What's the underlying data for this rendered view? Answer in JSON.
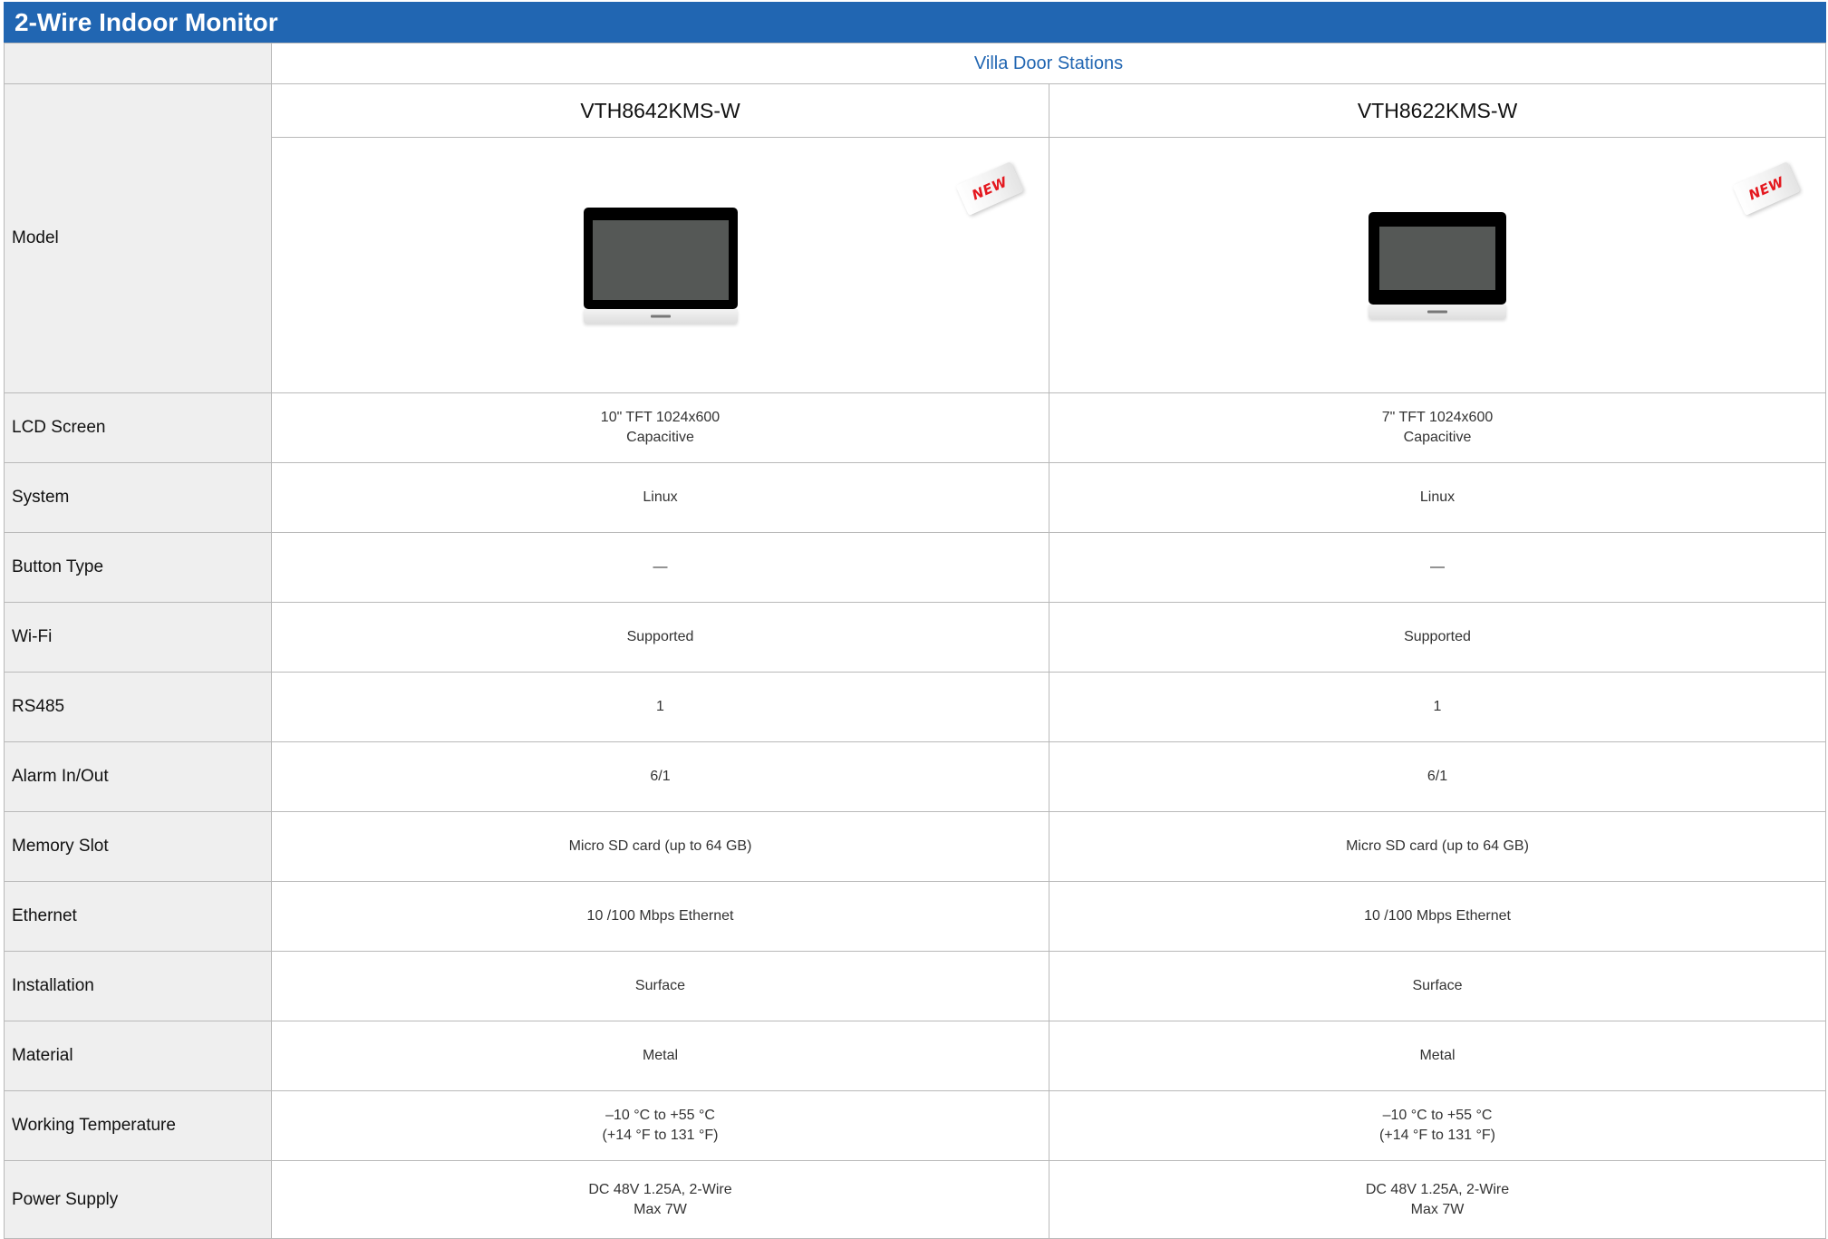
{
  "title": "2-Wire Indoor Monitor",
  "series": "Villa Door Stations",
  "colors": {
    "header_bg": "#2166b2",
    "badge_text": "#e4181f",
    "label_bg": "#efefef"
  },
  "models": [
    {
      "name": "VTH8642KMS-W",
      "badge": "NEW"
    },
    {
      "name": "VTH8622KMS-W",
      "badge": "NEW"
    }
  ],
  "rows": {
    "model_label": "Model",
    "lcd": {
      "label": "LCD Screen",
      "values": [
        [
          "10\" TFT 1024x600",
          "Capacitive"
        ],
        [
          "7\" TFT 1024x600",
          "Capacitive"
        ]
      ]
    },
    "system": {
      "label": "System",
      "values": [
        "Linux",
        "Linux"
      ]
    },
    "button": {
      "label": "Button Type",
      "values": [
        "—",
        "—"
      ]
    },
    "wifi": {
      "label": "Wi-Fi",
      "values": [
        "Supported",
        "Supported"
      ]
    },
    "rs485": {
      "label": "RS485",
      "values": [
        "1",
        "1"
      ]
    },
    "alarm": {
      "label": "Alarm In/Out",
      "values": [
        "6/1",
        "6/1"
      ]
    },
    "memory": {
      "label": "Memory Slot",
      "values": [
        "Micro SD card (up to 64 GB)",
        "Micro SD card (up to 64 GB)"
      ]
    },
    "ethernet": {
      "label": "Ethernet",
      "values": [
        "10 /100 Mbps Ethernet",
        "10 /100 Mbps Ethernet"
      ]
    },
    "installation": {
      "label": "Installation",
      "values": [
        "Surface",
        "Surface"
      ]
    },
    "material": {
      "label": "Material",
      "values": [
        "Metal",
        "Metal"
      ]
    },
    "temperature": {
      "label": "Working Temperature",
      "values": [
        [
          "–10 °C to +55 °C",
          "(+14 °F to 131 °F)"
        ],
        [
          "–10 °C to +55 °C",
          "(+14 °F to 131 °F)"
        ]
      ]
    },
    "power": {
      "label": "Power Supply",
      "values": [
        [
          "DC 48V  1.25A, 2-Wire",
          "Max 7W"
        ],
        [
          "DC 48V  1.25A, 2-Wire",
          "Max 7W"
        ]
      ]
    }
  }
}
